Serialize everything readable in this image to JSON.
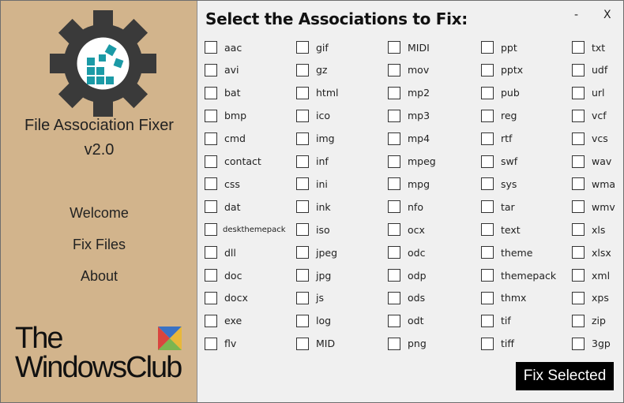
{
  "sidebar": {
    "app_title": "File Association Fixer",
    "version": "v2.0",
    "nav": [
      {
        "label": "Welcome"
      },
      {
        "label": "Fix Files"
      },
      {
        "label": "About"
      }
    ],
    "brand": {
      "line1": "The",
      "line2": "WindowsClub"
    },
    "colors": {
      "background": "#d2b48c",
      "gear": "#3a3a3a",
      "logo_accent": "#1b9aa6"
    }
  },
  "window": {
    "minimize_label": "-",
    "close_label": "X"
  },
  "main": {
    "heading": "Select the Associations to Fix:",
    "columns": [
      [
        "aac",
        "avi",
        "bat",
        "bmp",
        "cmd",
        "contact",
        "css",
        "dat",
        "deskthemepack",
        "dll",
        "doc",
        "docx",
        "exe",
        "flv"
      ],
      [
        "gif",
        "gz",
        "html",
        "ico",
        "img",
        "inf",
        "ini",
        "ink",
        "iso",
        "jpeg",
        "jpg",
        "js",
        "log",
        "MID"
      ],
      [
        "MIDI",
        "mov",
        "mp2",
        "mp3",
        "mp4",
        "mpeg",
        "mpg",
        "nfo",
        "ocx",
        "odc",
        "odp",
        "ods",
        "odt",
        "png"
      ],
      [
        "ppt",
        "pptx",
        "pub",
        "reg",
        "rtf",
        "swf",
        "sys",
        "tar",
        "text",
        "theme",
        "themepack",
        "thmx",
        "tif",
        "tiff"
      ],
      [
        "txt",
        "udf",
        "url",
        "vcf",
        "vcs",
        "wav",
        "wma",
        "wmv",
        "xls",
        "xlsx",
        "xml",
        "xps",
        "zip",
        "3gp"
      ]
    ],
    "fix_button_label": "Fix Selected"
  }
}
